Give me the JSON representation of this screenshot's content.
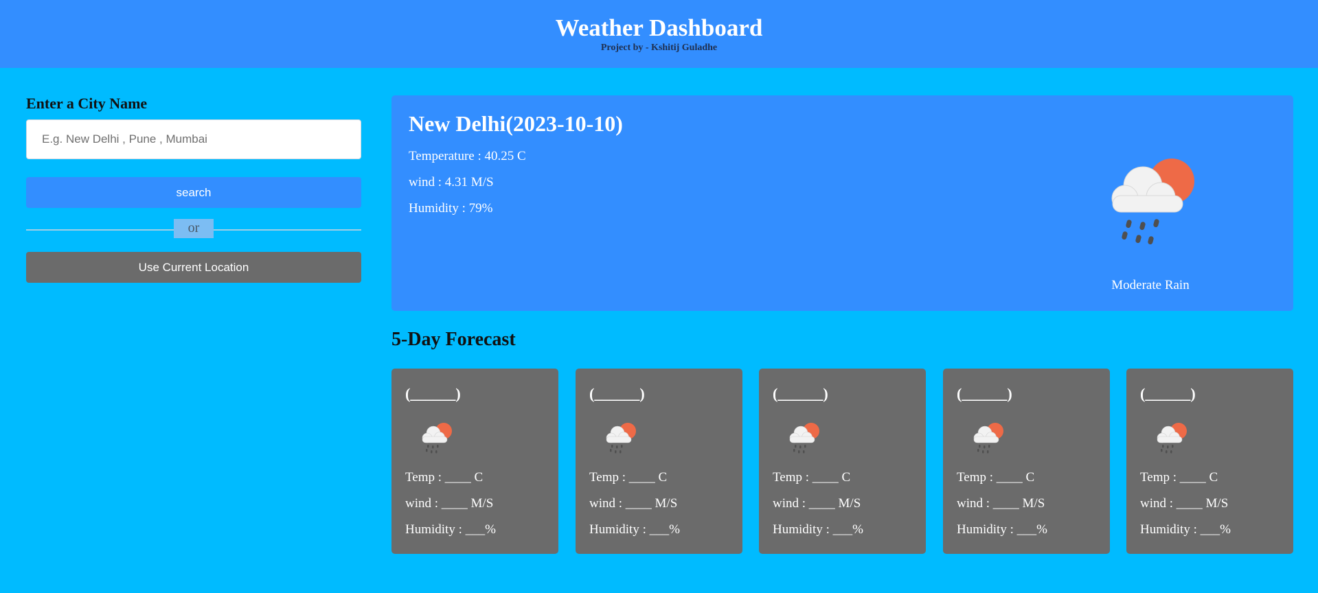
{
  "header": {
    "title": "Weather Dashboard",
    "subtitle": "Project by - Kshitij Guladhe"
  },
  "search_panel": {
    "label": "Enter a City Name",
    "input_value": "",
    "input_placeholder": "E.g. New Delhi , Pune , Mumbai",
    "search_button": "search",
    "or_text": "or",
    "location_button": "Use Current Location"
  },
  "current": {
    "title": "New Delhi(2023-10-10)",
    "temperature": "Temperature : 40.25 C",
    "wind": "wind : 4.31 M/S",
    "humidity": "Humidity : 79%",
    "description": "Moderate Rain",
    "icon": "moderate-rain-icon"
  },
  "forecast": {
    "title": "5-Day Forecast",
    "days": [
      {
        "date": "(______)",
        "temp": "Temp : ____ C",
        "wind": "wind : ____ M/S",
        "humidity": "Humidity : ___%",
        "icon": "rain-cloud-sun-icon"
      },
      {
        "date": "(______)",
        "temp": "Temp : ____ C",
        "wind": "wind : ____ M/S",
        "humidity": "Humidity : ___%",
        "icon": "rain-cloud-sun-icon"
      },
      {
        "date": "(______)",
        "temp": "Temp : ____ C",
        "wind": "wind : ____ M/S",
        "humidity": "Humidity : ___%",
        "icon": "rain-cloud-sun-icon"
      },
      {
        "date": "(______)",
        "temp": "Temp : ____ C",
        "wind": "wind : ____ M/S",
        "humidity": "Humidity : ___%",
        "icon": "rain-cloud-sun-icon"
      },
      {
        "date": "(______)",
        "temp": "Temp : ____ C",
        "wind": "wind : ____ M/S",
        "humidity": "Humidity : ___%",
        "icon": "rain-cloud-sun-icon"
      }
    ]
  },
  "colors": {
    "background": "#00bbff",
    "header": "#338eff",
    "card_primary": "#338eff",
    "card_secondary": "#6b6b6b",
    "sun": "#ee6a47",
    "cloud": "#f2f2f2",
    "rain": "#555555"
  }
}
